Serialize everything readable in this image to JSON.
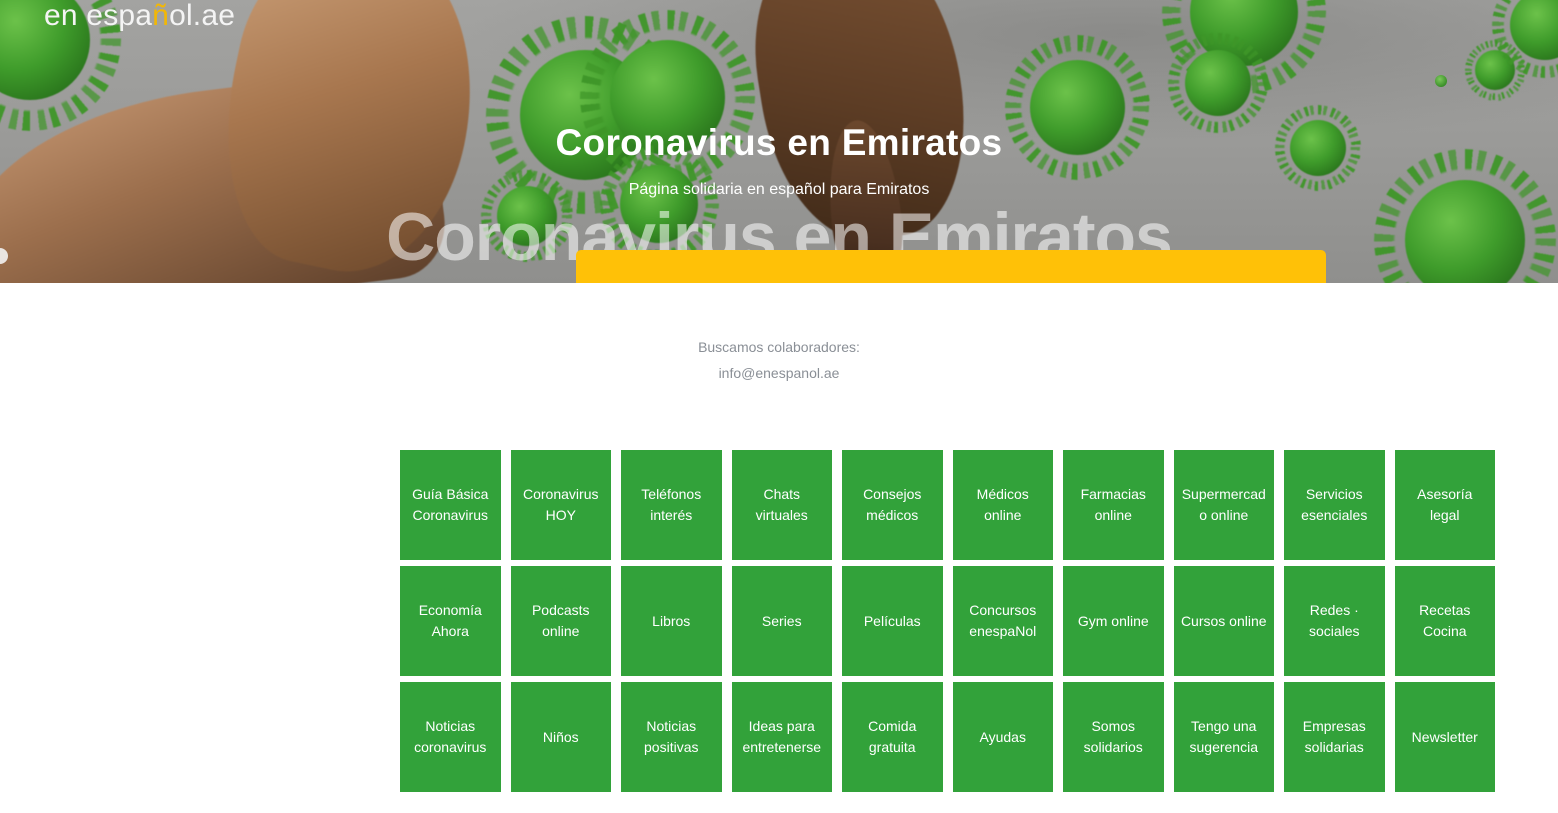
{
  "brand": {
    "text_before": "en espa",
    "tilde": "ñ",
    "text_after": "ol.ae",
    "full": "en español.ae",
    "tilde_color": "#F2B705"
  },
  "hero": {
    "title": "Coronavirus en Emiratos",
    "subtitle": "Página solidaria en español para Emiratos",
    "ghost_text": "Coronavirus en Emiratos",
    "cta_label": "",
    "cta_color": "#FFC107",
    "background_color": "#9a9a98"
  },
  "collaborators": {
    "line1": "Buscamos colaboradores:",
    "line2": "info@enespanol.ae"
  },
  "tiles": {
    "accent_color": "#32A23A",
    "text_color": "#FFFFFF",
    "items": [
      "Guía Básica Coronavirus",
      "Coronavirus HOY",
      "Teléfonos interés",
      "Chats virtuales",
      "Consejos médicos",
      "Médicos online",
      "Farmacias online",
      "Supermercado online",
      "Servicios esenciales",
      "Asesoría legal",
      "Economía Ahora",
      "Podcasts online",
      "Libros",
      "Series",
      "Películas",
      "Concursos enespaNol",
      "Gym online",
      "Cursos online",
      "Redes · sociales",
      "Recetas Cocina",
      "Noticias coronavirus",
      "Niños",
      "Noticias positivas",
      "Ideas para entretenerse",
      "Comida gratuita",
      "Ayudas",
      "Somos solidarios",
      "Tengo una sugerencia",
      "Empresas solidarias",
      "Newsletter"
    ]
  }
}
